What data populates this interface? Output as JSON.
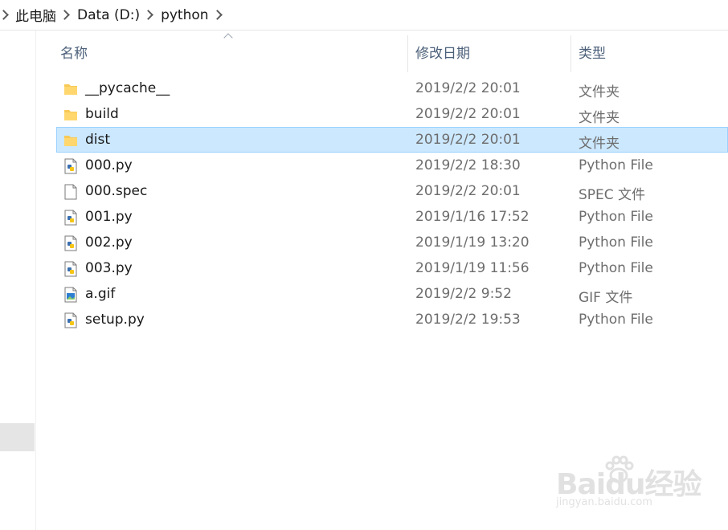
{
  "breadcrumb": {
    "items": [
      "此电脑",
      "Data (D:)",
      "python"
    ]
  },
  "columns": {
    "name": "名称",
    "date": "修改日期",
    "type": "类型"
  },
  "files": [
    {
      "name": "__pycache__",
      "date": "2019/2/2 20:01",
      "type": "文件夹",
      "icon": "folder-icon"
    },
    {
      "name": "build",
      "date": "2019/2/2 20:01",
      "type": "文件夹",
      "icon": "folder-icon"
    },
    {
      "name": "dist",
      "date": "2019/2/2 20:01",
      "type": "文件夹",
      "icon": "folder-icon",
      "selected": true
    },
    {
      "name": "000.py",
      "date": "2019/2/2 18:30",
      "type": "Python File",
      "icon": "python-file-icon"
    },
    {
      "name": "000.spec",
      "date": "2019/2/2 20:01",
      "type": "SPEC 文件",
      "icon": "blank-file-icon"
    },
    {
      "name": "001.py",
      "date": "2019/1/16 17:52",
      "type": "Python File",
      "icon": "python-file-icon"
    },
    {
      "name": "002.py",
      "date": "2019/1/19 13:20",
      "type": "Python File",
      "icon": "python-file-icon"
    },
    {
      "name": "003.py",
      "date": "2019/1/19 11:56",
      "type": "Python File",
      "icon": "python-file-icon"
    },
    {
      "name": "a.gif",
      "date": "2019/2/2 9:52",
      "type": "GIF 文件",
      "icon": "image-file-icon"
    },
    {
      "name": "setup.py",
      "date": "2019/2/2 19:53",
      "type": "Python File",
      "icon": "python-file-icon"
    }
  ],
  "watermark": {
    "logo": "Baidu经验",
    "url": "jingyan.baidu.com"
  },
  "colors": {
    "selection_bg": "#cce8ff",
    "selection_border": "#99d1ff",
    "header_text": "#4c607a",
    "folder_yellow": "#f8c957"
  }
}
